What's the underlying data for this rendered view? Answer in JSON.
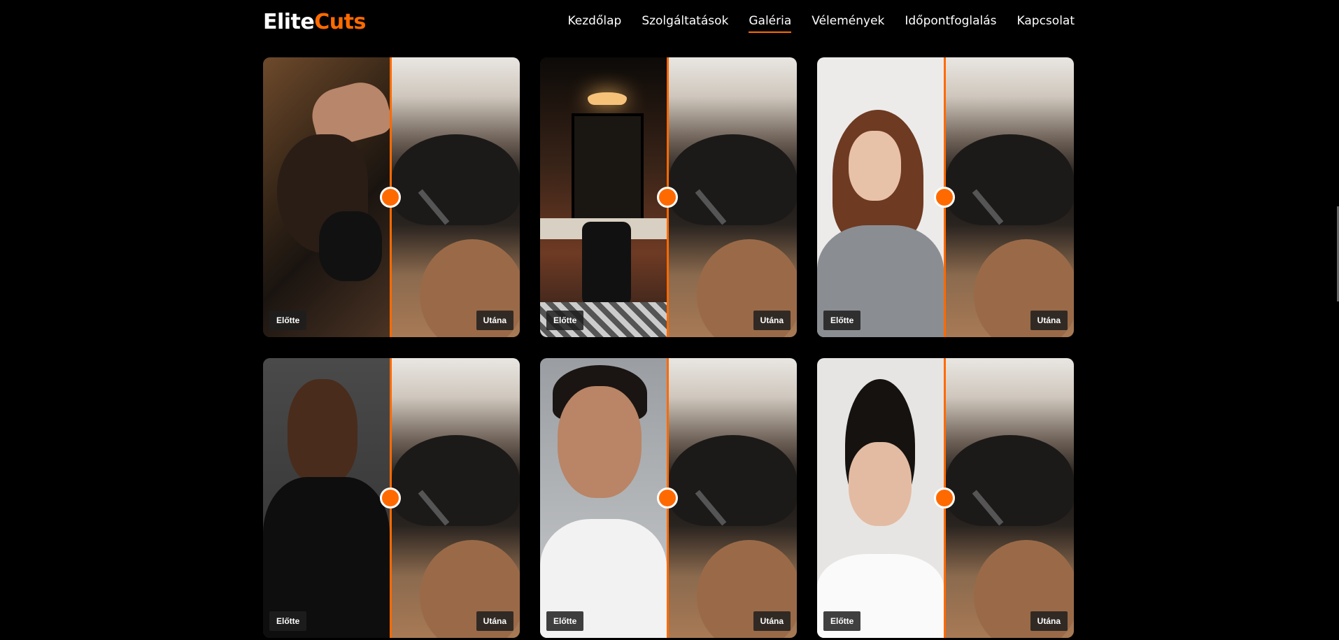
{
  "brand": {
    "part1": "Elite",
    "part2": "Cuts"
  },
  "nav": [
    {
      "label": "Kezdőlap",
      "active": false
    },
    {
      "label": "Szolgáltatások",
      "active": false
    },
    {
      "label": "Galéria",
      "active": true
    },
    {
      "label": "Vélemények",
      "active": false
    },
    {
      "label": "Időpontfoglalás",
      "active": false
    },
    {
      "label": "Kapcsolat",
      "active": false
    }
  ],
  "gallery": [
    {
      "before_label": "Előtte",
      "after_label": "Utána"
    },
    {
      "before_label": "Előtte",
      "after_label": "Utána"
    },
    {
      "before_label": "Előtte",
      "after_label": "Utána"
    },
    {
      "before_label": "Előtte",
      "after_label": "Utána"
    },
    {
      "before_label": "Előtte",
      "after_label": "Utána"
    },
    {
      "before_label": "Előtte",
      "after_label": "Utána"
    }
  ],
  "colors": {
    "accent": "#ff6a00",
    "background": "#000000"
  }
}
